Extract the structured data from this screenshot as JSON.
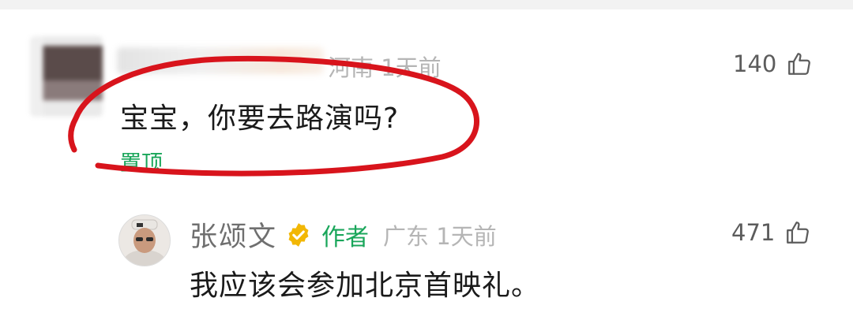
{
  "top_comment": {
    "location": "河南",
    "time": "1天前",
    "likes": "140",
    "text": "宝宝，你要去路演吗?",
    "pinned_label": "置顶"
  },
  "reply": {
    "author": "张颂文",
    "author_tag": "作者",
    "location": "广东",
    "time": "1天前",
    "likes": "471",
    "text": "我应该会参加北京首映礼。"
  },
  "colors": {
    "accent_green": "#19a65a",
    "annotation_red": "#d8141c",
    "verified_gold": "#f2b705"
  },
  "icons": [
    "thumbs-up-icon",
    "verified-badge-icon"
  ]
}
